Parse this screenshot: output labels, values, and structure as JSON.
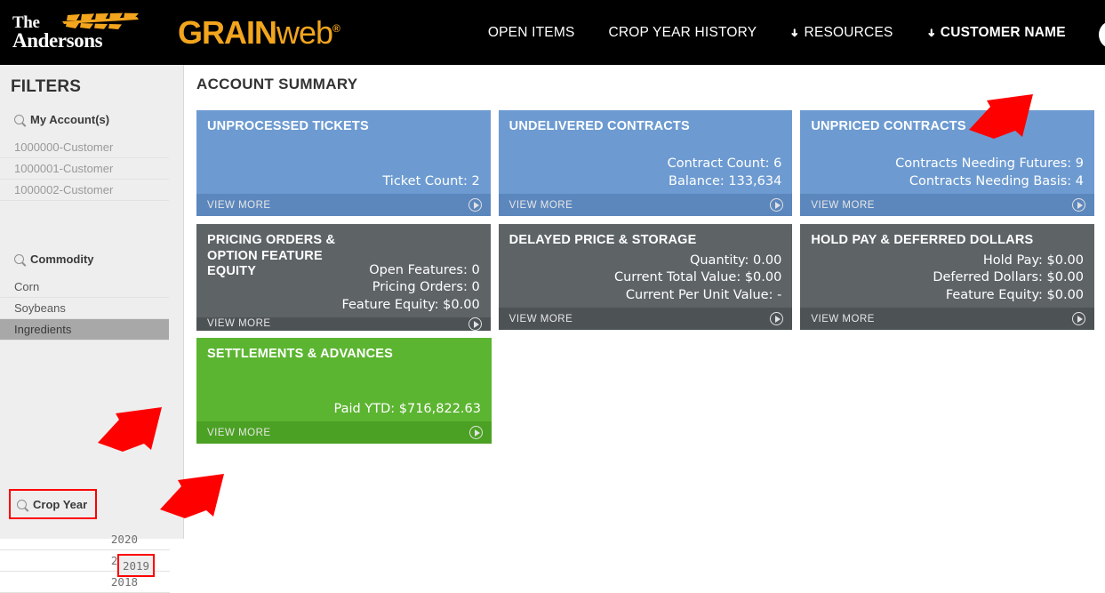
{
  "header": {
    "logo_primary_line1": "The",
    "logo_primary_line2": "Andersons",
    "logo_secondary_bold": "GRAIN",
    "logo_secondary_light": "web",
    "logo_secondary_mark": "®",
    "nav": [
      {
        "label": "OPEN ITEMS",
        "has_chevron": false,
        "bold": false
      },
      {
        "label": "CROP YEAR HISTORY",
        "has_chevron": false,
        "bold": false
      },
      {
        "label": "RESOURCES",
        "has_chevron": true,
        "bold": false
      },
      {
        "label": "CUSTOMER NAME",
        "has_chevron": true,
        "bold": true
      }
    ],
    "avatar_badge_count": "0",
    "accent_color": "#f2a51d",
    "background_color": "#000000"
  },
  "sidebar": {
    "title": "FILTERS",
    "groups": [
      {
        "heading": "My Account(s)",
        "icon": "search-icon",
        "items": [
          {
            "label": "1000000-Customer",
            "selected": false
          },
          {
            "label": "1000001-Customer",
            "selected": false
          },
          {
            "label": "1000002-Customer",
            "selected": false
          }
        ]
      },
      {
        "heading": "Commodity",
        "icon": "search-icon",
        "items": [
          {
            "label": "Corn",
            "selected": false
          },
          {
            "label": "Soybeans",
            "selected": false
          },
          {
            "label": "Ingredients",
            "selected": true
          }
        ]
      },
      {
        "heading": "Crop Year",
        "icon": "search-icon",
        "highlighted": true,
        "items": [
          {
            "label": "2020",
            "selected": false,
            "highlighted": false
          },
          {
            "label": "2019",
            "selected": false,
            "highlighted": true
          },
          {
            "label": "2018",
            "selected": false,
            "highlighted": false
          }
        ]
      }
    ]
  },
  "main": {
    "page_title": "ACCOUNT SUMMARY",
    "view_more_label": "VIEW MORE",
    "cards": [
      {
        "title": "UNPROCESSED TICKETS",
        "color": "blue",
        "color_hex": "#6d9bd1",
        "metrics": [
          "Ticket Count: 2"
        ],
        "annotated": false
      },
      {
        "title": "UNDELIVERED CONTRACTS",
        "color": "blue",
        "color_hex": "#6d9bd1",
        "metrics": [
          "Contract Count: 6",
          "Balance: 133,634"
        ],
        "annotated": false
      },
      {
        "title": "UNPRICED CONTRACTS",
        "color": "blue",
        "color_hex": "#6d9bd1",
        "metrics": [
          "Contracts Needing Futures: 9",
          "Contracts Needing Basis: 4"
        ],
        "annotated": true
      },
      {
        "title": "PRICING ORDERS & OPTION FEATURE EQUITY",
        "color": "gray",
        "color_hex": "#5e6366",
        "metrics": [
          "Open Features: 0",
          "Pricing Orders: 0",
          "Feature Equity: $0.00"
        ],
        "annotated": false
      },
      {
        "title": "DELAYED PRICE & STORAGE",
        "color": "gray",
        "color_hex": "#5e6366",
        "metrics": [
          "Quantity: 0.00",
          "Current Total Value: $0.00",
          "Current Per Unit Value: -"
        ],
        "annotated": false
      },
      {
        "title": "HOLD PAY & DEFERRED DOLLARS",
        "color": "gray",
        "color_hex": "#5e6366",
        "metrics": [
          "Hold Pay: $0.00",
          "Deferred Dollars: $0.00",
          "Feature Equity: $0.00"
        ],
        "annotated": false
      },
      {
        "title": "SETTLEMENTS & ADVANCES",
        "color": "green",
        "color_hex": "#5cb531",
        "metrics": [
          "Paid YTD: $716,822.63"
        ],
        "annotated": false
      }
    ]
  },
  "annotations": {
    "arrow_color": "#ff0000",
    "highlight_color": "#ff0000",
    "arrows": [
      {
        "target": "unpriced-contracts-card"
      },
      {
        "target": "crop-year-filter"
      },
      {
        "target": "crop-year-2019"
      }
    ]
  }
}
